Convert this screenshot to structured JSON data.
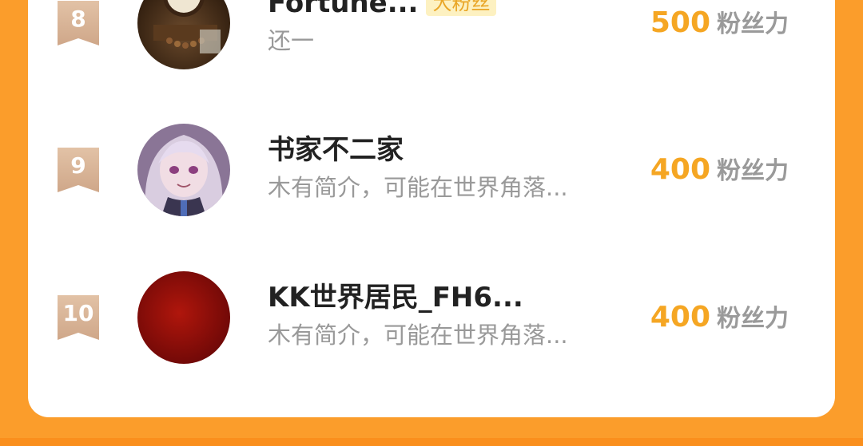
{
  "rows": [
    {
      "rank": "8",
      "name": "Fortune...",
      "badge": "大粉丝",
      "bio": "还一",
      "score": "500",
      "unit": "粉丝力",
      "avatar_icon": "clock-photo-avatar"
    },
    {
      "rank": "9",
      "name": "书家不二家",
      "badge": "",
      "bio": "木有简介，可能在世界角落...",
      "score": "400",
      "unit": "粉丝力",
      "avatar_icon": "anime-girl-avatar"
    },
    {
      "rank": "10",
      "name": "KK世界居民_FH6...",
      "badge": "",
      "bio": "木有简介，可能在世界角落...",
      "score": "400",
      "unit": "粉丝力",
      "avatar_icon": "red-circle-avatar"
    }
  ],
  "colors": {
    "background": "#fb9d2b",
    "score": "#f5a623",
    "rank_ribbon": "#d9b497",
    "badge_bg": "#fdf1c1",
    "badge_text": "#e9a626"
  }
}
